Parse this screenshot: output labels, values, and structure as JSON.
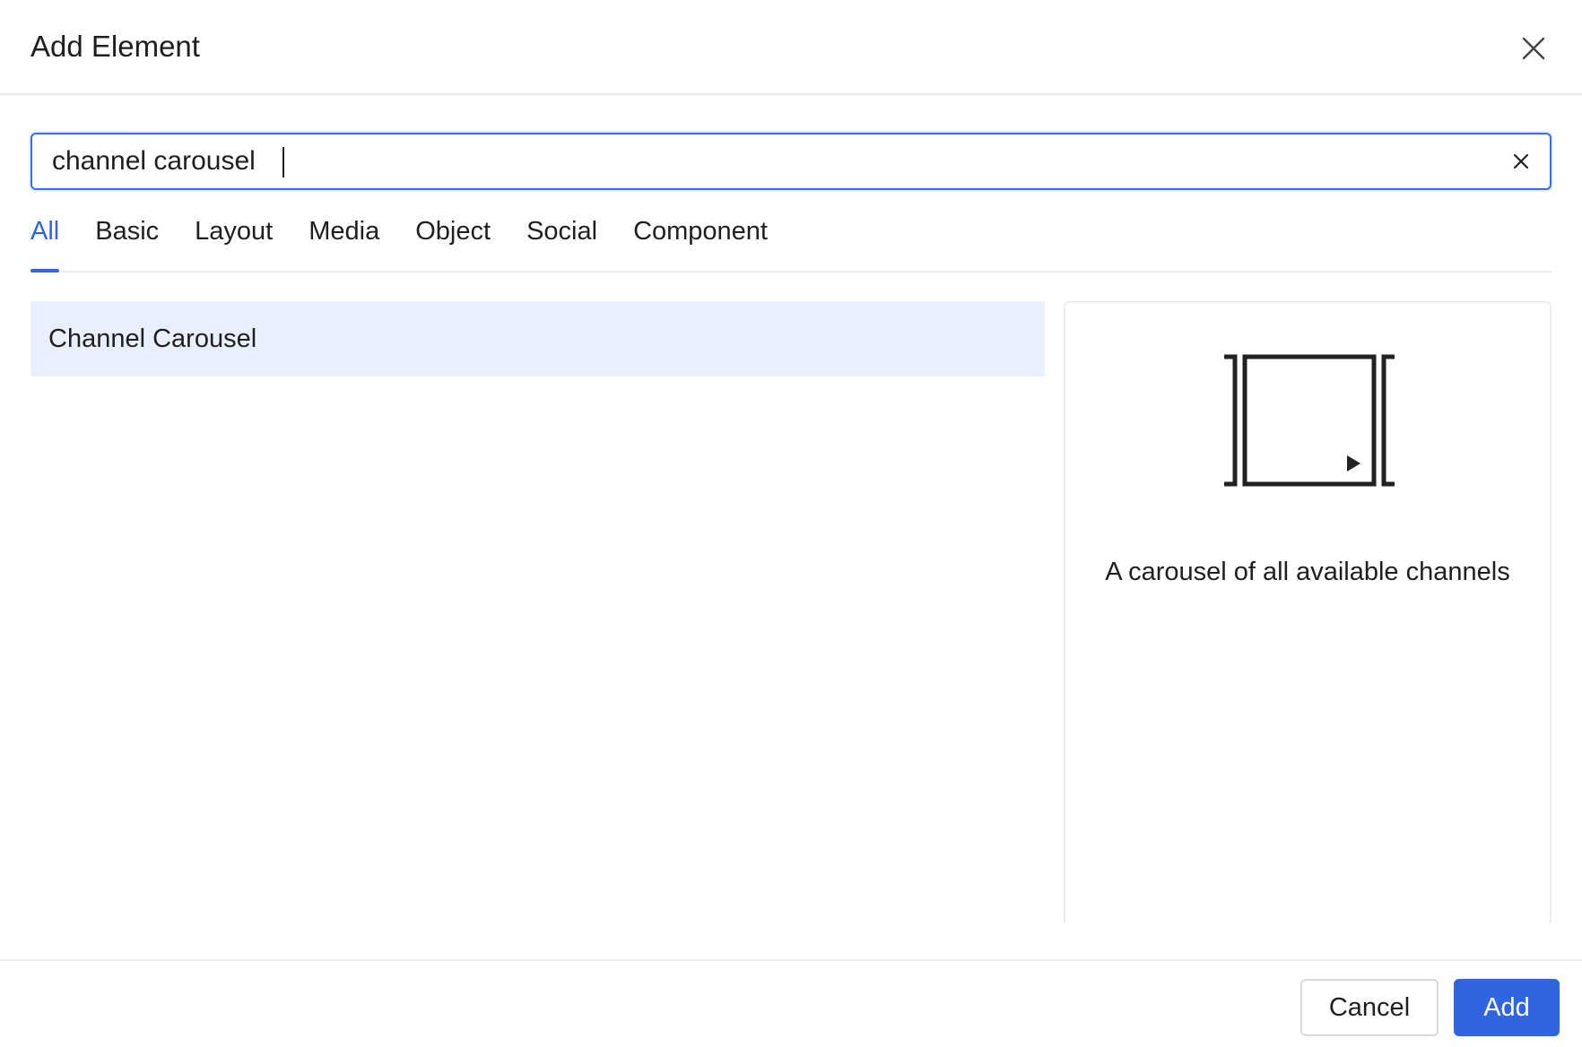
{
  "dialog": {
    "title": "Add Element"
  },
  "search": {
    "value": "channel carousel",
    "placeholder": ""
  },
  "tabs": [
    {
      "label": "All",
      "active": true
    },
    {
      "label": "Basic",
      "active": false
    },
    {
      "label": "Layout",
      "active": false
    },
    {
      "label": "Media",
      "active": false
    },
    {
      "label": "Object",
      "active": false
    },
    {
      "label": "Social",
      "active": false
    },
    {
      "label": "Component",
      "active": false
    }
  ],
  "results": [
    {
      "label": "Channel Carousel",
      "selected": true
    }
  ],
  "preview": {
    "icon": "carousel-icon",
    "description": "A carousel of all available channels"
  },
  "footer": {
    "cancel_label": "Cancel",
    "add_label": "Add"
  },
  "colors": {
    "accent": "#2f65e0",
    "selected_bg": "#e9effd"
  }
}
